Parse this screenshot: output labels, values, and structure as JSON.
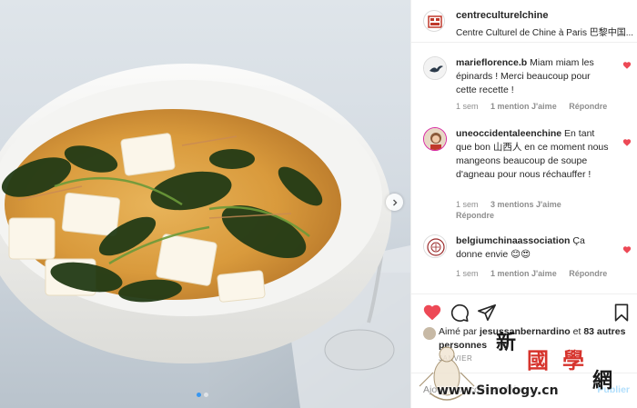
{
  "post": {
    "account": {
      "username": "centreculturelchine",
      "display_username": "centreculturelchine",
      "subtitle": "Centre Culturel de Chine à Paris 巴黎中国..."
    },
    "carousel": {
      "dots": 2,
      "active_dot": 0
    }
  },
  "comments": [
    {
      "username": "marieflorence.b",
      "text": "Miam miam les épinards ! Merci beaucoup pour cette recette !",
      "time": "1 sem",
      "likes": "1 mention J'aime",
      "reply": "Répondre"
    },
    {
      "username": "uneoccidentaleenchine",
      "text": "En tant que bon 山西人 en ce moment nous mangeons beaucoup de soupe d'agneau pour nous réchauffer !",
      "time": "1 sem",
      "likes": "3 mentions J'aime",
      "reply": "Répondre"
    },
    {
      "username": "belgiumchinaassociation",
      "text": "Ça donne envie 😊😍",
      "time": "1 sem",
      "likes": "1 mention J'aime",
      "reply": "Répondre"
    }
  ],
  "likes": {
    "prefix": "Aimé par",
    "user": "jesussanbernardino",
    "conj": "et",
    "others": "83 autres personnes"
  },
  "date": "JANVIER",
  "add_comment": {
    "placeholder": "Ajouter un commentaire...",
    "publish": "Publier"
  },
  "watermark": {
    "chars": [
      "新",
      "國",
      "學",
      "網"
    ],
    "url": "www.Sinology.cn"
  },
  "colors": {
    "like_red": "#ed4956",
    "link_blue": "#3897f0",
    "muted_gray": "#8e8e8e",
    "publish_blue": "#b2dffc"
  },
  "icons": [
    "heart-icon",
    "comment-icon",
    "share-icon",
    "bookmark-icon",
    "chevron-right-icon"
  ]
}
